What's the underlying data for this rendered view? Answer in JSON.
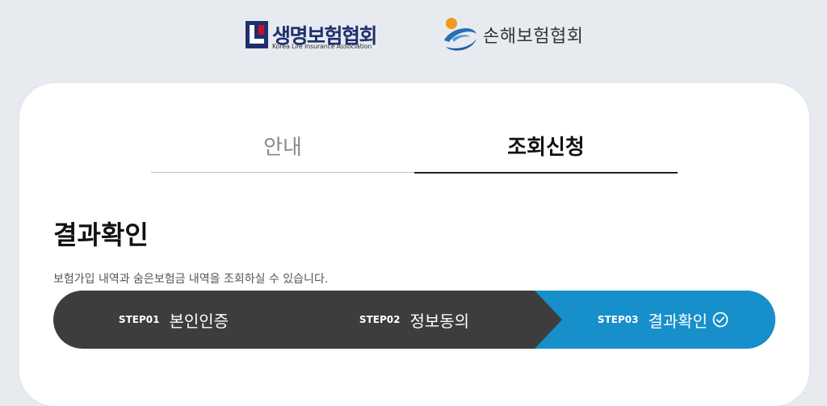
{
  "header": {
    "life_logo": {
      "name": "생명보험협회",
      "subtitle": "Korea Life Insurance Association"
    },
    "general_logo": {
      "name": "손해보험협회"
    }
  },
  "tabs": [
    {
      "label": "안내",
      "active": false
    },
    {
      "label": "조회신청",
      "active": true
    }
  ],
  "page": {
    "title": "결과확인",
    "description": "보험가입 내역과 숨은보험금 내역을 조회하실 수 있습니다."
  },
  "steps": [
    {
      "number": "STEP01",
      "label": "본인인증",
      "state": "done"
    },
    {
      "number": "STEP02",
      "label": "정보동의",
      "state": "done"
    },
    {
      "number": "STEP03",
      "label": "결과확인",
      "state": "active"
    }
  ],
  "colors": {
    "background": "#e7ebf0",
    "step_inactive": "#3d3d3d",
    "step_active": "#168fca",
    "life_brand_blue": "#1f2f6e",
    "life_brand_red": "#c8102e",
    "general_brand_orange": "#f29a1f",
    "general_brand_blue": "#2a6db0"
  },
  "icons": {
    "life_logo": "kl-square-mark",
    "general_logo": "swoosh-sun-mark",
    "step_complete": "check-circle-icon"
  }
}
